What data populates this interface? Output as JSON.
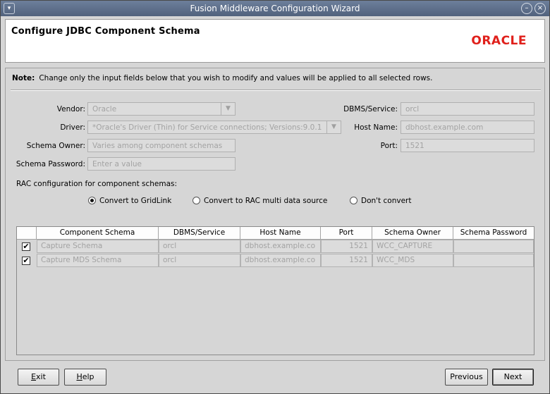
{
  "window": {
    "title": "Fusion Middleware Configuration Wizard",
    "controls": {
      "menu": "▾",
      "minimize": "–",
      "close": "×"
    }
  },
  "header": {
    "heading": "Configure JDBC Component Schema",
    "logo": "ORACLE",
    "logo_color": "#e0201b"
  },
  "note": {
    "label": "Note:",
    "text": "Change only the input fields below that you wish to modify and values will be applied to all selected rows."
  },
  "form": {
    "vendor": {
      "label": "Vendor:",
      "value": "Oracle"
    },
    "driver": {
      "label": "Driver:",
      "value": "*Oracle's Driver (Thin) for Service connections; Versions:9.0.1"
    },
    "schema_owner": {
      "label": "Schema Owner:",
      "value": "Varies among component schemas"
    },
    "schema_password": {
      "label": "Schema Password:",
      "placeholder": "Enter a value"
    },
    "dbms_service": {
      "label": "DBMS/Service:",
      "value": "orcl"
    },
    "host_name": {
      "label": "Host Name:",
      "value": "dbhost.example.com"
    },
    "port": {
      "label": "Port:",
      "value": "1521"
    },
    "dropdown_icon": "▼"
  },
  "rac": {
    "question": "RAC configuration for component schemas:",
    "options": [
      {
        "label": "Convert to GridLink",
        "selected": true
      },
      {
        "label": "Convert to RAC multi data source",
        "selected": false
      },
      {
        "label": "Don't convert",
        "selected": false
      }
    ]
  },
  "table": {
    "columns": [
      "Component Schema",
      "DBMS/Service",
      "Host Name",
      "Port",
      "Schema Owner",
      "Schema Password"
    ],
    "rows": [
      {
        "checked": "✔",
        "schema": "Capture Schema",
        "dbms": "orcl",
        "host": "dbhost.example.co",
        "port": "1521",
        "owner": "WCC_CAPTURE",
        "password": ""
      },
      {
        "checked": "✔",
        "schema": "Capture MDS Schema",
        "dbms": "orcl",
        "host": "dbhost.example.co",
        "port": "1521",
        "owner": "WCC_MDS",
        "password": ""
      }
    ]
  },
  "buttons": {
    "exit_mnemonic": "E",
    "exit_rest": "xit",
    "help_mnemonic": "H",
    "help_rest": "elp",
    "previous_label": "Previous",
    "next_label": "Next"
  }
}
